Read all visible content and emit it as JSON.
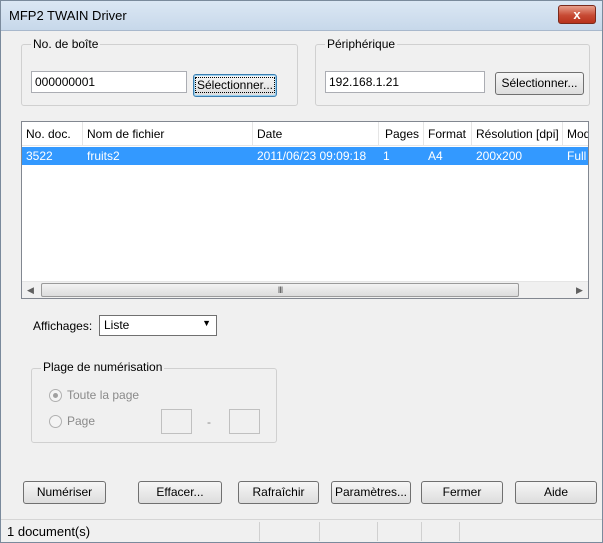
{
  "window": {
    "title": "MFP2 TWAIN Driver",
    "close_glyph": "x"
  },
  "box_group": {
    "label": "No. de boîte",
    "value": "000000001",
    "button": "Sélectionner..."
  },
  "device_group": {
    "label": "Périphérique",
    "value": "192.168.1.21",
    "button": "Sélectionner..."
  },
  "table": {
    "columns": [
      "No. doc.",
      "Nom de fichier",
      "Date",
      "Pages",
      "Format",
      "Résolution [dpi]",
      "Mod"
    ],
    "rows": [
      {
        "doc": "3522",
        "name": "fruits2",
        "date": "2011/06/23 09:09:18",
        "pages": "1",
        "format": "A4",
        "resolution": "200x200",
        "mode": "Full C"
      }
    ],
    "scroll_thumb_glyph": "III"
  },
  "display": {
    "label": "Affichages:",
    "value": "Liste"
  },
  "scan_range": {
    "label": "Plage de numérisation",
    "option_full": "Toute la page",
    "option_page": "Page",
    "separator": "-"
  },
  "buttons": {
    "scan": "Numériser",
    "delete": "Effacer...",
    "refresh": "Rafraîchir",
    "settings": "Paramètres...",
    "close": "Fermer",
    "help": "Aide"
  },
  "status": {
    "text": "1 document(s)"
  }
}
